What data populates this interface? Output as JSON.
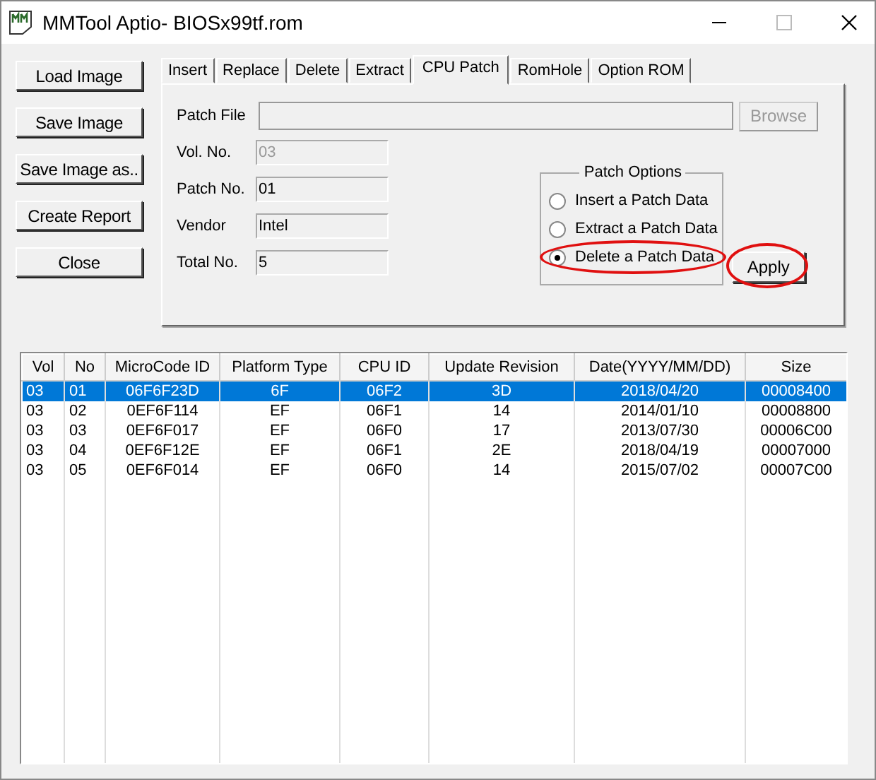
{
  "window": {
    "title": "MMTool Aptio- BIOSx99tf.rom"
  },
  "side_buttons": [
    "Load Image",
    "Save Image",
    "Save Image as..",
    "Create Report",
    "Close"
  ],
  "tabs": [
    {
      "label": "Insert",
      "selected": false
    },
    {
      "label": "Replace",
      "selected": false
    },
    {
      "label": "Delete",
      "selected": false
    },
    {
      "label": "Extract",
      "selected": false
    },
    {
      "label": "CPU Patch",
      "selected": true
    },
    {
      "label": "RomHole",
      "selected": false
    },
    {
      "label": "Option ROM",
      "selected": false
    }
  ],
  "patch_file": {
    "label": "Patch File",
    "browse": {
      "label": "Browse",
      "disabled": true
    }
  },
  "fields": [
    {
      "label": "Vol. No.",
      "value": "03",
      "disabled": true
    },
    {
      "label": "Patch No.",
      "value": "01",
      "disabled": false
    },
    {
      "label": "Vendor",
      "value": "Intel",
      "disabled": false
    },
    {
      "label": "Total No.",
      "value": "5",
      "disabled": false
    }
  ],
  "patch_options": {
    "title": "Patch Options",
    "options": [
      {
        "label": "Insert a Patch Data",
        "selected": false,
        "highlighted": false
      },
      {
        "label": "Extract a Patch Data",
        "selected": false,
        "highlighted": false
      },
      {
        "label": "Delete a Patch Data",
        "selected": true,
        "highlighted": true
      }
    ]
  },
  "apply": {
    "label": "Apply",
    "highlighted": true
  },
  "table": {
    "columns": [
      "Vol",
      "No",
      "MicroCode ID",
      "Platform Type",
      "CPU ID",
      "Update Revision",
      "Date(YYYY/MM/DD)",
      "Size"
    ],
    "rows": [
      {
        "cells": [
          "03",
          "01",
          "06F6F23D",
          "6F",
          "06F2",
          "3D",
          "2018/04/20",
          "00008400"
        ],
        "selected": true
      },
      {
        "cells": [
          "03",
          "02",
          "0EF6F114",
          "EF",
          "06F1",
          "14",
          "2014/01/10",
          "00008800"
        ],
        "selected": false
      },
      {
        "cells": [
          "03",
          "03",
          "0EF6F017",
          "EF",
          "06F0",
          "17",
          "2013/07/30",
          "00006C00"
        ],
        "selected": false
      },
      {
        "cells": [
          "03",
          "04",
          "0EF6F12E",
          "EF",
          "06F1",
          "2E",
          "2018/04/19",
          "00007000"
        ],
        "selected": false
      },
      {
        "cells": [
          "03",
          "05",
          "0EF6F014",
          "EF",
          "06F0",
          "14",
          "2015/07/02",
          "00007C00"
        ],
        "selected": false
      }
    ]
  }
}
